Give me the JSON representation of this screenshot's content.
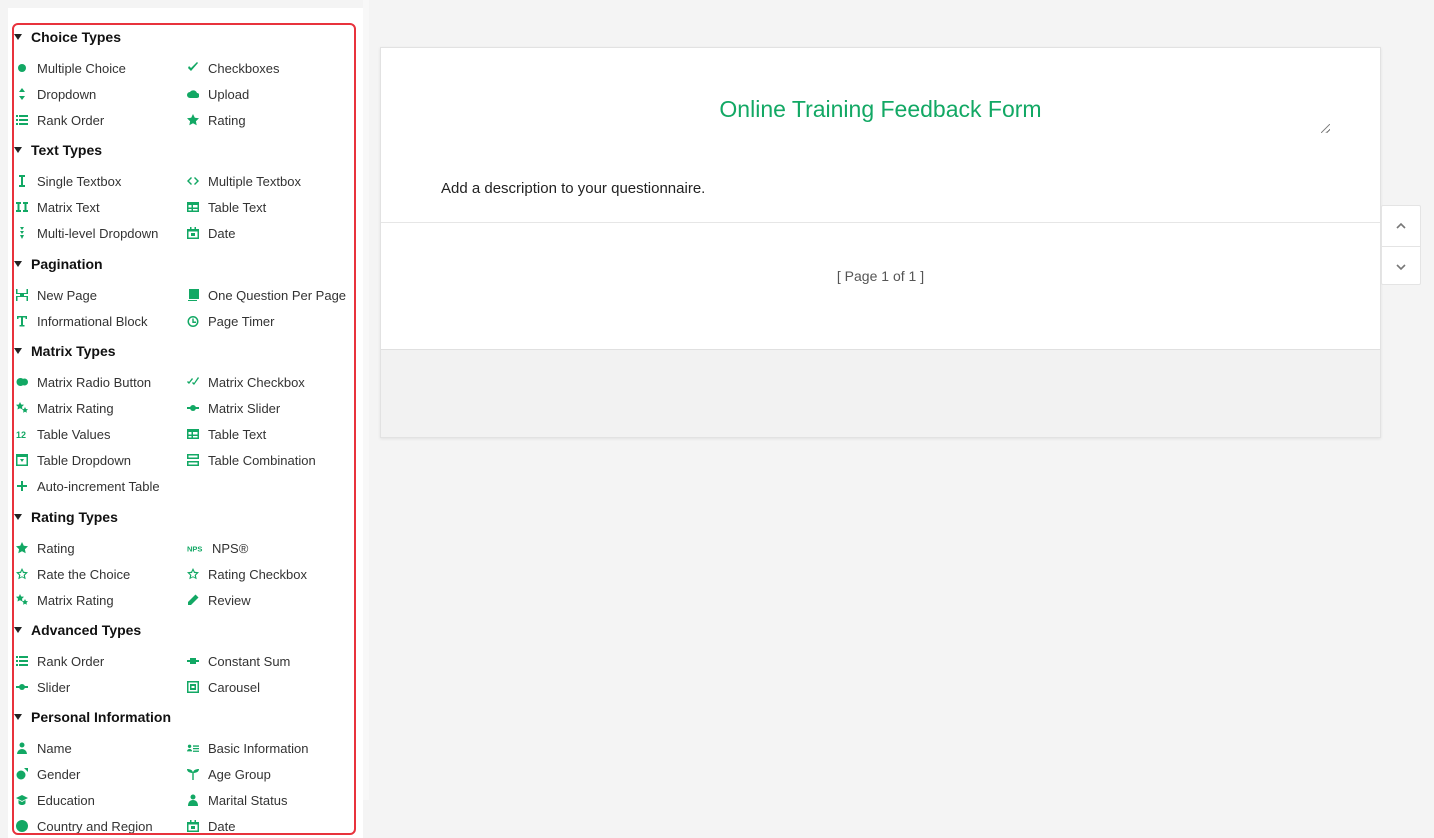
{
  "sidebar": {
    "sections": [
      {
        "title": "Choice Types",
        "items": [
          {
            "label": "Multiple Choice",
            "icon": "radio-dot-icon"
          },
          {
            "label": "Checkboxes",
            "icon": "checkmark-icon"
          },
          {
            "label": "Dropdown",
            "icon": "dropdown-arrows-icon"
          },
          {
            "label": "Upload",
            "icon": "cloud-upload-icon"
          },
          {
            "label": "Rank Order",
            "icon": "list-icon"
          },
          {
            "label": "Rating",
            "icon": "star-icon"
          }
        ]
      },
      {
        "title": "Text Types",
        "items": [
          {
            "label": "Single Textbox",
            "icon": "text-cursor-icon"
          },
          {
            "label": "Multiple Textbox",
            "icon": "code-brackets-icon"
          },
          {
            "label": "Matrix Text",
            "icon": "double-cursor-icon"
          },
          {
            "label": "Table Text",
            "icon": "table-icon"
          },
          {
            "label": "Multi-level Dropdown",
            "icon": "cascade-icon"
          },
          {
            "label": "Date",
            "icon": "calendar-icon"
          }
        ]
      },
      {
        "title": "Pagination",
        "items": [
          {
            "label": "New Page",
            "icon": "page-break-icon"
          },
          {
            "label": "One Question Per Page",
            "icon": "pages-icon"
          },
          {
            "label": "Informational Block",
            "icon": "text-t-icon"
          },
          {
            "label": "Page Timer",
            "icon": "timer-icon"
          }
        ]
      },
      {
        "title": "Matrix Types",
        "items": [
          {
            "label": "Matrix Radio Button",
            "icon": "matrix-radio-icon"
          },
          {
            "label": "Matrix Checkbox",
            "icon": "matrix-check-icon"
          },
          {
            "label": "Matrix Rating",
            "icon": "matrix-star-icon"
          },
          {
            "label": "Matrix Slider",
            "icon": "slider-icon"
          },
          {
            "label": "Table Values",
            "icon": "numbers-icon"
          },
          {
            "label": "Table Text",
            "icon": "table-icon"
          },
          {
            "label": "Table Dropdown",
            "icon": "table-dropdown-icon"
          },
          {
            "label": "Table Combination",
            "icon": "table-combination-icon"
          },
          {
            "label": "Auto-increment Table",
            "icon": "plus-icon"
          }
        ]
      },
      {
        "title": "Rating Types",
        "items": [
          {
            "label": "Rating",
            "icon": "star-icon"
          },
          {
            "label": "NPS®",
            "icon": "nps-icon"
          },
          {
            "label": "Rate the Choice",
            "icon": "star-outline-icon"
          },
          {
            "label": "Rating Checkbox",
            "icon": "star-check-icon"
          },
          {
            "label": "Matrix Rating",
            "icon": "matrix-star-icon"
          },
          {
            "label": "Review",
            "icon": "pencil-icon"
          }
        ]
      },
      {
        "title": "Advanced Types",
        "items": [
          {
            "label": "Rank Order",
            "icon": "list-icon"
          },
          {
            "label": "Constant Sum",
            "icon": "sum-icon"
          },
          {
            "label": "Slider",
            "icon": "slider-icon"
          },
          {
            "label": "Carousel",
            "icon": "carousel-icon"
          }
        ]
      },
      {
        "title": "Personal Information",
        "items": [
          {
            "label": "Name",
            "icon": "person-icon"
          },
          {
            "label": "Basic Information",
            "icon": "id-card-icon"
          },
          {
            "label": "Gender",
            "icon": "gender-icon"
          },
          {
            "label": "Age Group",
            "icon": "sprout-icon"
          },
          {
            "label": "Education",
            "icon": "graduation-cap-icon"
          },
          {
            "label": "Marital Status",
            "icon": "couple-icon"
          },
          {
            "label": "Country and Region",
            "icon": "globe-icon"
          },
          {
            "label": "Date",
            "icon": "calendar-icon"
          }
        ]
      }
    ]
  },
  "form": {
    "title": "Online Training Feedback Form",
    "description": "Add a description to your questionnaire.",
    "page_indicator": "[ Page 1 of 1 ]"
  },
  "colors": {
    "accent": "#12a864",
    "highlight_border": "#e8323c"
  }
}
